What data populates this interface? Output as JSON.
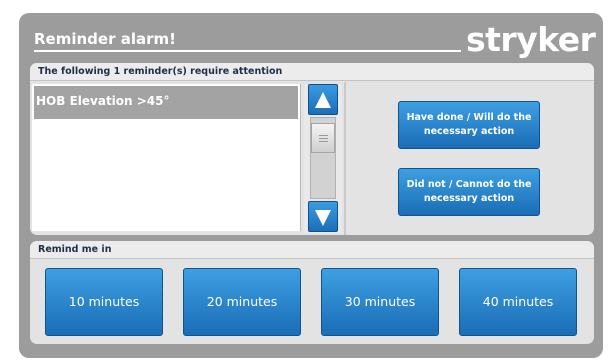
{
  "header": {
    "title": "Reminder alarm!",
    "logo": "stryker"
  },
  "reminders": {
    "heading": "The following 1 reminder(s) require attention",
    "items": [
      {
        "label": "HOB Elevation >45°"
      }
    ]
  },
  "actions": {
    "done_label": "Have done / Will do the necessary action",
    "not_done_label": "Did not / Cannot do the necessary action"
  },
  "remind": {
    "heading": "Remind me in",
    "options": [
      {
        "label": "10 minutes"
      },
      {
        "label": "20 minutes"
      },
      {
        "label": "30 minutes"
      },
      {
        "label": "40 minutes"
      }
    ]
  },
  "colors": {
    "frame": "#9c9c9c",
    "button_blue": "#1a6db6",
    "selected_row": "#a3a3a3"
  }
}
